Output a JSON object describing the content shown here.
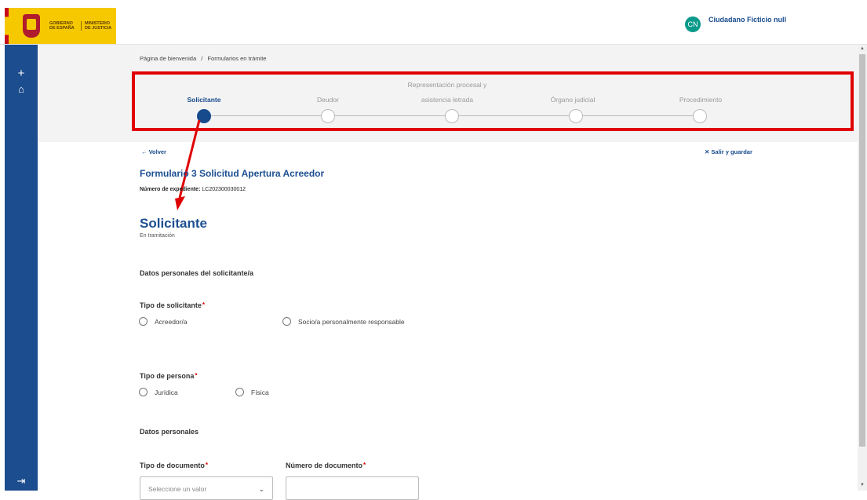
{
  "header": {
    "logo_left_text": "GOBIERNO DE ESPAÑA",
    "logo_right_text": "MINISTERIO DE JUSTICIA",
    "user_initials": "CN",
    "user_name": "Ciudadano Ficticio null"
  },
  "sidebar": {
    "add_icon": "+",
    "home_icon": "⌂",
    "logout_icon": "⇥"
  },
  "breadcrumb": {
    "items": [
      "Página de bienvenida",
      "/",
      "Formularios en trámite"
    ]
  },
  "stepper": {
    "steps": [
      {
        "label": "Solicitante",
        "active": true
      },
      {
        "label": "Deudor",
        "active": false
      },
      {
        "label_line1": "Representación procesal y",
        "label_line2": "asistencia letrada",
        "active": false
      },
      {
        "label": "Órgano judicial",
        "active": false
      },
      {
        "label": "Procedimiento",
        "active": false
      }
    ]
  },
  "nav": {
    "back_label": "← Volver",
    "exit_label": "✕  Salir y guardar"
  },
  "form": {
    "title": "Formulario 3  Solicitud Apertura Acreedor",
    "expediente_label": "Número de expediente:",
    "expediente_value": "LC202300030012",
    "section_title": "Solicitante",
    "section_status": "En tramitación",
    "personal_data_heading": "Datos personales del solicitante/a",
    "tipo_solicitante_label": "Tipo de solicitante",
    "tipo_solicitante_options": [
      "Acreedor/a",
      "Socio/a personalmente responsable"
    ],
    "tipo_persona_label": "Tipo de persona",
    "tipo_persona_options": [
      "Jurídica",
      "Física"
    ],
    "datos_personales_heading": "Datos personales",
    "tipo_documento_label": "Tipo de documento",
    "tipo_documento_placeholder": "Seleccione un valor",
    "numero_documento_label": "Número de documento",
    "required_mark": "*"
  },
  "colors": {
    "brand_blue": "#1d4f91",
    "sidebar_blue": "#1c4d8e",
    "highlight_red": "#e00000",
    "avatar_teal": "#0a9a8a"
  }
}
